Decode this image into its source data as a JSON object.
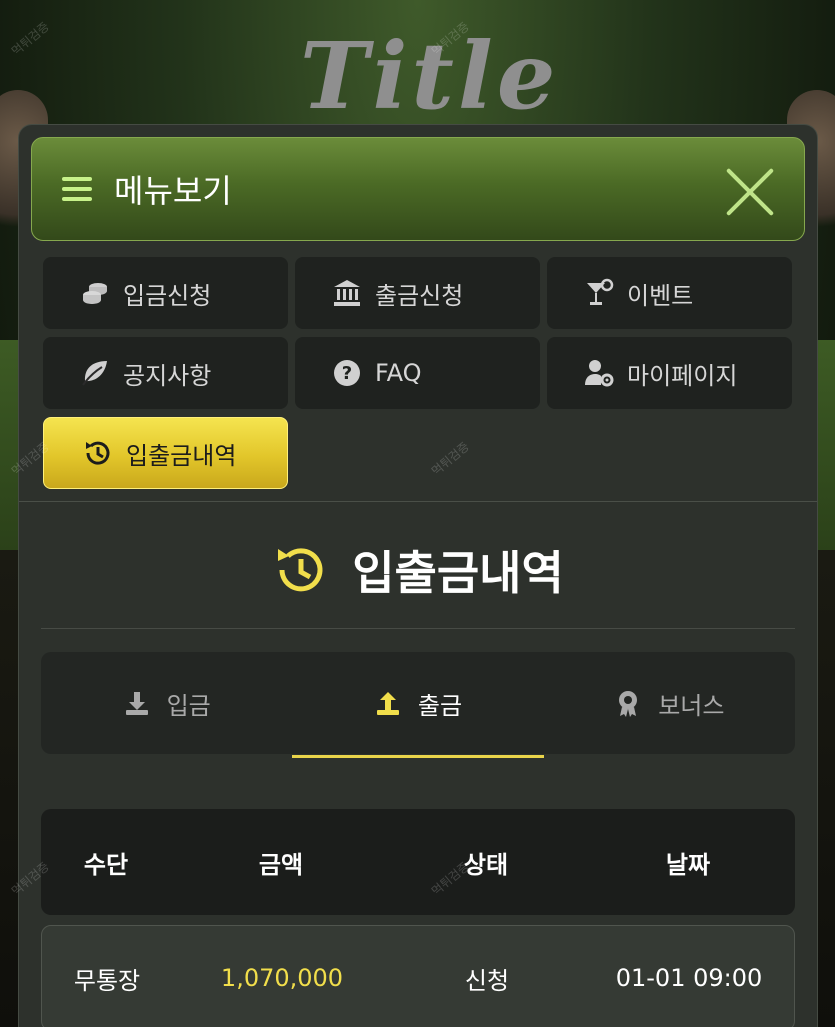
{
  "background": {
    "logo_text": "Title",
    "watermark_text": "먹튀검증"
  },
  "menu": {
    "title": "메뉴보기",
    "items": [
      {
        "label": "입금신청",
        "icon": "coins-icon"
      },
      {
        "label": "출금신청",
        "icon": "bank-icon"
      },
      {
        "label": "이벤트",
        "icon": "cocktail-icon"
      },
      {
        "label": "공지사항",
        "icon": "leaf-icon"
      },
      {
        "label": "FAQ",
        "icon": "question-icon"
      },
      {
        "label": "마이페이지",
        "icon": "user-cog-icon"
      },
      {
        "label": "입출금내역",
        "icon": "history-icon",
        "active": true
      }
    ]
  },
  "section": {
    "title": "입출금내역"
  },
  "tabs": [
    {
      "label": "입금",
      "icon": "download-icon"
    },
    {
      "label": "출금",
      "icon": "upload-icon",
      "active": true
    },
    {
      "label": "보너스",
      "icon": "award-icon"
    }
  ],
  "table": {
    "headers": [
      "수단",
      "금액",
      "상태",
      "날짜"
    ],
    "rows": [
      {
        "method": "무통장",
        "amount": "1,070,000",
        "status": "신청",
        "date": "01-01 09:00"
      }
    ]
  },
  "colors": {
    "accent": "#e9d44a",
    "header_green": "#4b6a25",
    "panel_bg": "#2d312c"
  }
}
